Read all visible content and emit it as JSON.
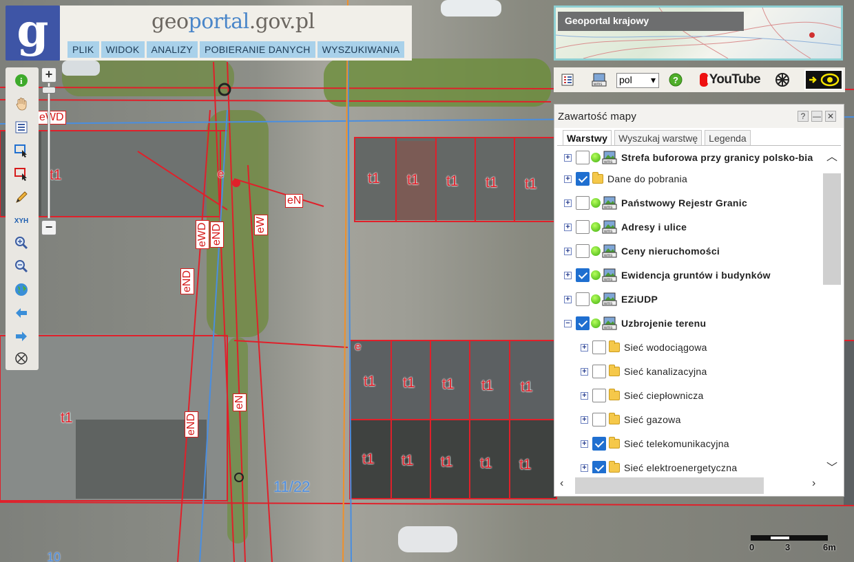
{
  "header": {
    "logo_letter": "g",
    "site_title_geo": "geo",
    "site_title_portal": "portal",
    "site_title_rest": ".gov.pl",
    "menu": [
      "PLIK",
      "WIDOK",
      "ANALIZY",
      "POBIERANIE DANYCH",
      "WYSZUKIWANIA"
    ]
  },
  "overview": {
    "title": "Geoportal krajowy"
  },
  "toolbar": {
    "language": "pol",
    "youtube_label": "YouTube",
    "icons": [
      "layers-legend-icon",
      "wms-icon",
      "help-icon",
      "youtube-icon",
      "settings-wheel-icon",
      "eye-contrast-icon"
    ]
  },
  "left_tools": {
    "icons": [
      "info-icon",
      "pan-hand-icon",
      "legend-list-icon",
      "select-rectangle-icon",
      "select-red-icon",
      "pencil-icon",
      "xyh-coordinates-icon",
      "zoom-in-icon",
      "zoom-out-icon",
      "globe-icon",
      "back-arrow-icon",
      "forward-arrow-icon",
      "compass-icon"
    ],
    "xyh_label": "XYH",
    "zoom_plus": "+",
    "zoom_minus": "−"
  },
  "panel": {
    "title": "Zawartość mapy",
    "help_btn": "?",
    "minimize_btn": "—",
    "close_btn": "✕",
    "tabs": [
      {
        "label": "Warstwy",
        "active": true
      },
      {
        "label": "Wyszukaj warstwę",
        "active": false
      },
      {
        "label": "Legenda",
        "active": false
      }
    ],
    "layers": [
      {
        "label": "Strefa buforowa przy granicy polsko-bia",
        "checked": false,
        "bold": true,
        "type": "wms",
        "indent": 0,
        "expander": "+"
      },
      {
        "label": "Dane do pobrania",
        "checked": true,
        "bold": false,
        "type": "folder",
        "indent": 0,
        "expander": "+"
      },
      {
        "label": "Państwowy Rejestr Granic",
        "checked": false,
        "bold": true,
        "type": "wms",
        "indent": 0,
        "expander": "+"
      },
      {
        "label": "Adresy i ulice",
        "checked": false,
        "bold": true,
        "type": "wms",
        "indent": 0,
        "expander": "+"
      },
      {
        "label": "Ceny nieruchomości",
        "checked": false,
        "bold": true,
        "type": "wms",
        "indent": 0,
        "expander": "+"
      },
      {
        "label": "Ewidencja gruntów i budynków",
        "checked": true,
        "bold": true,
        "type": "wms",
        "indent": 0,
        "expander": "+"
      },
      {
        "label": "EZiUDP",
        "checked": false,
        "bold": true,
        "type": "wms",
        "indent": 0,
        "expander": "+"
      },
      {
        "label": "Uzbrojenie terenu",
        "checked": true,
        "bold": true,
        "type": "wms",
        "indent": 0,
        "expander": "−"
      },
      {
        "label": "Sieć wodociągowa",
        "checked": false,
        "bold": false,
        "type": "folder",
        "indent": 1,
        "expander": "+"
      },
      {
        "label": "Sieć kanalizacyjna",
        "checked": false,
        "bold": false,
        "type": "folder",
        "indent": 1,
        "expander": "+"
      },
      {
        "label": "Sieć ciepłownicza",
        "checked": false,
        "bold": false,
        "type": "folder",
        "indent": 1,
        "expander": "+"
      },
      {
        "label": "Sieć gazowa",
        "checked": false,
        "bold": false,
        "type": "folder",
        "indent": 1,
        "expander": "+"
      },
      {
        "label": "Sieć telekomunikacyjna",
        "checked": true,
        "bold": false,
        "type": "folder",
        "indent": 1,
        "expander": "+"
      },
      {
        "label": "Sieć elektroenergetyczna",
        "checked": true,
        "bold": false,
        "type": "folder",
        "indent": 1,
        "expander": "+"
      }
    ]
  },
  "map": {
    "parcel_label": "t1",
    "parcel_number": "11/22",
    "parcel_number_2": "10",
    "network_labels": {
      "ewd": "eWD",
      "end": "eND",
      "en": "eN",
      "ew": "eW",
      "e": "e"
    }
  },
  "scale": {
    "labels": [
      "0",
      "3",
      "6m"
    ]
  },
  "colors": {
    "accent": "#3e55a6",
    "menu_bg": "#a9d1ea",
    "network_red": "#e0202a",
    "checkbox_blue": "#1f6fd0"
  }
}
